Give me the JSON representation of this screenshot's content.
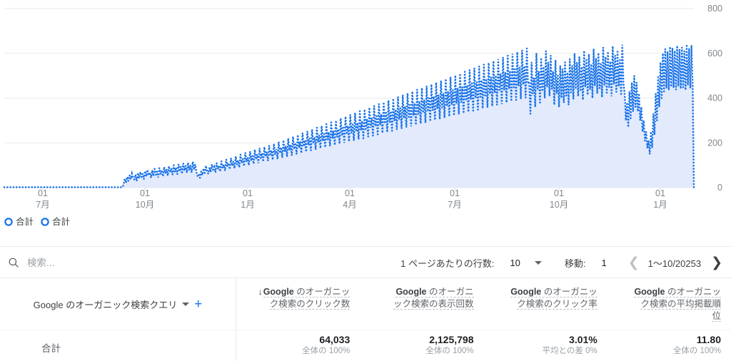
{
  "chart_data": {
    "type": "area",
    "title": "",
    "xlabel": "",
    "ylabel": "",
    "ylim": [
      0,
      800
    ],
    "y_ticks": [
      "0",
      "200",
      "400",
      "600",
      "800"
    ],
    "y_tick_values": [
      0,
      200,
      400,
      600,
      800
    ],
    "grid": true,
    "legend_position": "bottom-left",
    "x_tick_labels": [
      {
        "day": "01",
        "month": "7月"
      },
      {
        "day": "01",
        "month": "10月"
      },
      {
        "day": "01",
        "month": "1月"
      },
      {
        "day": "01",
        "month": "4月"
      },
      {
        "day": "01",
        "month": "7月"
      },
      {
        "day": "01",
        "month": "10月"
      },
      {
        "day": "01",
        "month": "1月"
      }
    ],
    "series": [
      {
        "name": "合計",
        "color": "#1a73e8",
        "fill": "#e3eafc",
        "style": "dotted-line-with-area",
        "values": [
          2,
          2,
          2,
          2,
          2,
          2,
          2,
          2,
          2,
          2,
          2,
          2,
          2,
          2,
          2,
          2,
          2,
          2,
          2,
          2,
          2,
          2,
          2,
          2,
          2,
          2,
          2,
          2,
          2,
          2,
          2,
          2,
          2,
          2,
          2,
          2,
          2,
          2,
          2,
          2,
          2,
          2,
          2,
          2,
          2,
          2,
          2,
          2,
          2,
          2,
          2,
          2,
          2,
          2,
          2,
          2,
          2,
          2,
          2,
          2,
          2,
          2,
          2,
          2,
          2,
          2,
          2,
          2,
          2,
          2,
          2,
          2,
          2,
          2,
          2,
          2,
          2,
          2,
          2,
          2,
          2,
          2,
          2,
          2,
          2,
          2,
          2,
          2,
          2,
          2,
          2,
          2,
          2,
          2,
          2,
          2,
          2,
          2,
          2,
          2,
          14,
          40,
          22,
          48,
          30,
          55,
          38,
          62,
          44,
          36,
          58,
          30,
          66,
          42,
          70,
          48,
          62,
          38,
          74,
          50,
          80,
          55,
          68,
          44,
          78,
          52,
          84,
          58,
          72,
          46,
          88,
          60,
          78,
          50,
          92,
          64,
          82,
          54,
          96,
          68,
          86,
          58,
          100,
          70,
          90,
          60,
          104,
          72,
          94,
          62,
          108,
          76,
          98,
          66,
          112,
          78,
          100,
          68,
          116,
          80,
          104,
          70,
          52,
          60,
          44,
          72,
          56,
          86,
          66,
          98,
          74,
          62,
          90,
          70,
          104,
          80,
          92,
          68,
          110,
          84,
          96,
          72,
          118,
          88,
          102,
          76,
          126,
          94,
          110,
          82,
          132,
          98,
          116,
          86,
          140,
          104,
          122,
          90,
          148,
          110,
          128,
          96,
          156,
          116,
          134,
          100,
          162,
          120,
          142,
          106,
          170,
          126,
          148,
          110,
          176,
          132,
          154,
          116,
          182,
          138,
          160,
          120,
          188,
          142,
          166,
          124,
          196,
          148,
          172,
          128,
          204,
          154,
          180,
          134,
          212,
          160,
          186,
          138,
          220,
          166,
          192,
          144,
          228,
          172,
          200,
          150,
          236,
          178,
          206,
          154,
          244,
          184,
          212,
          160,
          252,
          190,
          220,
          166,
          260,
          196,
          226,
          170,
          268,
          202,
          234,
          176,
          276,
          208,
          240,
          180,
          284,
          214,
          248,
          186,
          292,
          220,
          254,
          190,
          300,
          226,
          262,
          196,
          310,
          232,
          268,
          200,
          318,
          238,
          276,
          206,
          326,
          244,
          282,
          210,
          334,
          250,
          290,
          216,
          342,
          256,
          298,
          220,
          350,
          262,
          306,
          228,
          358,
          268,
          312,
          232,
          366,
          274,
          320,
          238,
          374,
          280,
          328,
          244,
          382,
          286,
          334,
          248,
          390,
          292,
          342,
          254,
          398,
          298,
          350,
          260,
          406,
          304,
          356,
          264,
          414,
          310,
          364,
          270,
          422,
          316,
          370,
          274,
          430,
          322,
          378,
          280,
          438,
          328,
          386,
          286,
          446,
          334,
          392,
          290,
          454,
          340,
          400,
          296,
          462,
          346,
          408,
          302,
          470,
          352,
          414,
          306,
          478,
          358,
          422,
          312,
          486,
          364,
          430,
          318,
          494,
          370,
          436,
          322,
          502,
          376,
          444,
          328,
          510,
          382,
          450,
          332,
          518,
          388,
          458,
          338,
          526,
          394,
          466,
          344,
          534,
          400,
          472,
          348,
          542,
          406,
          480,
          354,
          550,
          412,
          486,
          358,
          558,
          418,
          494,
          364,
          566,
          424,
          502,
          370,
          574,
          430,
          508,
          374,
          582,
          436,
          516,
          380,
          590,
          442,
          522,
          386,
          598,
          448,
          530,
          392,
          606,
          454,
          538,
          396,
          614,
          460,
          544,
          402,
          622,
          466,
          470,
          330,
          560,
          420,
          490,
          360,
          600,
          440,
          520,
          380,
          580,
          430,
          540,
          400,
          610,
          450,
          560,
          410,
          590,
          440,
          520,
          370,
          570,
          420,
          500,
          360,
          545,
          400,
          530,
          380,
          560,
          410,
          515,
          370,
          575,
          425,
          545,
          395,
          600,
          440,
          560,
          408,
          585,
          430,
          540,
          392,
          612,
          450,
          570,
          414,
          596,
          438,
          552,
          400,
          620,
          455,
          578,
          420,
          602,
          444,
          558,
          404,
          626,
          458,
          584,
          424,
          608,
          448,
          564,
          408,
          632,
          462,
          590,
          428,
          614,
          452,
          570,
          412,
          638,
          466,
          420,
          300,
          380,
          270,
          430,
          310,
          470,
          340,
          500,
          360,
          470,
          340,
          420,
          300,
          360,
          250,
          300,
          210,
          250,
          176,
          210,
          150,
          250,
          178,
          330,
          236,
          420,
          300,
          500,
          360,
          560,
          400,
          600,
          430,
          620,
          444,
          608,
          436,
          630,
          450,
          624,
          446,
          612,
          438,
          634,
          452,
          618,
          442,
          626,
          448,
          610,
          436,
          640,
          458,
          622,
          444,
          636,
          456,
          0
        ]
      },
      {
        "name": "合計",
        "color": "#1a73e8",
        "style": "dotted-line"
      }
    ]
  },
  "legend": {
    "items": [
      {
        "label": "合計",
        "color": "#1a73e8"
      },
      {
        "label": "合計",
        "color": "#1a73e8"
      }
    ]
  },
  "toolbar": {
    "search_placeholder": "検索...",
    "rows_per_page_label": "1 ページあたりの行数:",
    "rows_per_page_value": "10",
    "goto_label": "移動:",
    "goto_value": "1",
    "range_label": "1〜10/20253"
  },
  "table": {
    "dimension_header": "Google のオーガニック検索クエリ",
    "metrics": [
      {
        "id": "clicks",
        "sorted": true,
        "sort_glyph": "↓",
        "brand": "Google",
        "rest": " のオーガニッ",
        "line2": "ク検索のクリック数"
      },
      {
        "id": "impressions",
        "sorted": false,
        "sort_glyph": "",
        "brand": "Google",
        "rest": " のオーガニ",
        "line2": "ック検索の表示回数"
      },
      {
        "id": "ctr",
        "sorted": false,
        "sort_glyph": "",
        "brand": "Google",
        "rest": " のオーガニッ",
        "line2": "ク検索のクリック率"
      },
      {
        "id": "position",
        "sorted": false,
        "sort_glyph": "",
        "brand": "Google",
        "rest": " のオーガニッ",
        "line2": "ク検索の平均掲載順",
        "line3": "位"
      }
    ],
    "total_row": {
      "label": "合計",
      "cells": [
        {
          "value": "64,033",
          "sub": "全体の 100%"
        },
        {
          "value": "2,125,798",
          "sub": "全体の 100%"
        },
        {
          "value": "3.01%",
          "sub": "平均との差 0%"
        },
        {
          "value": "11.80",
          "sub": "全体の 100%"
        }
      ]
    }
  },
  "colors": {
    "accent": "#1a73e8",
    "area_fill": "#e3eafc",
    "grid": "#e8eaed",
    "text_secondary": "#5f6368"
  }
}
